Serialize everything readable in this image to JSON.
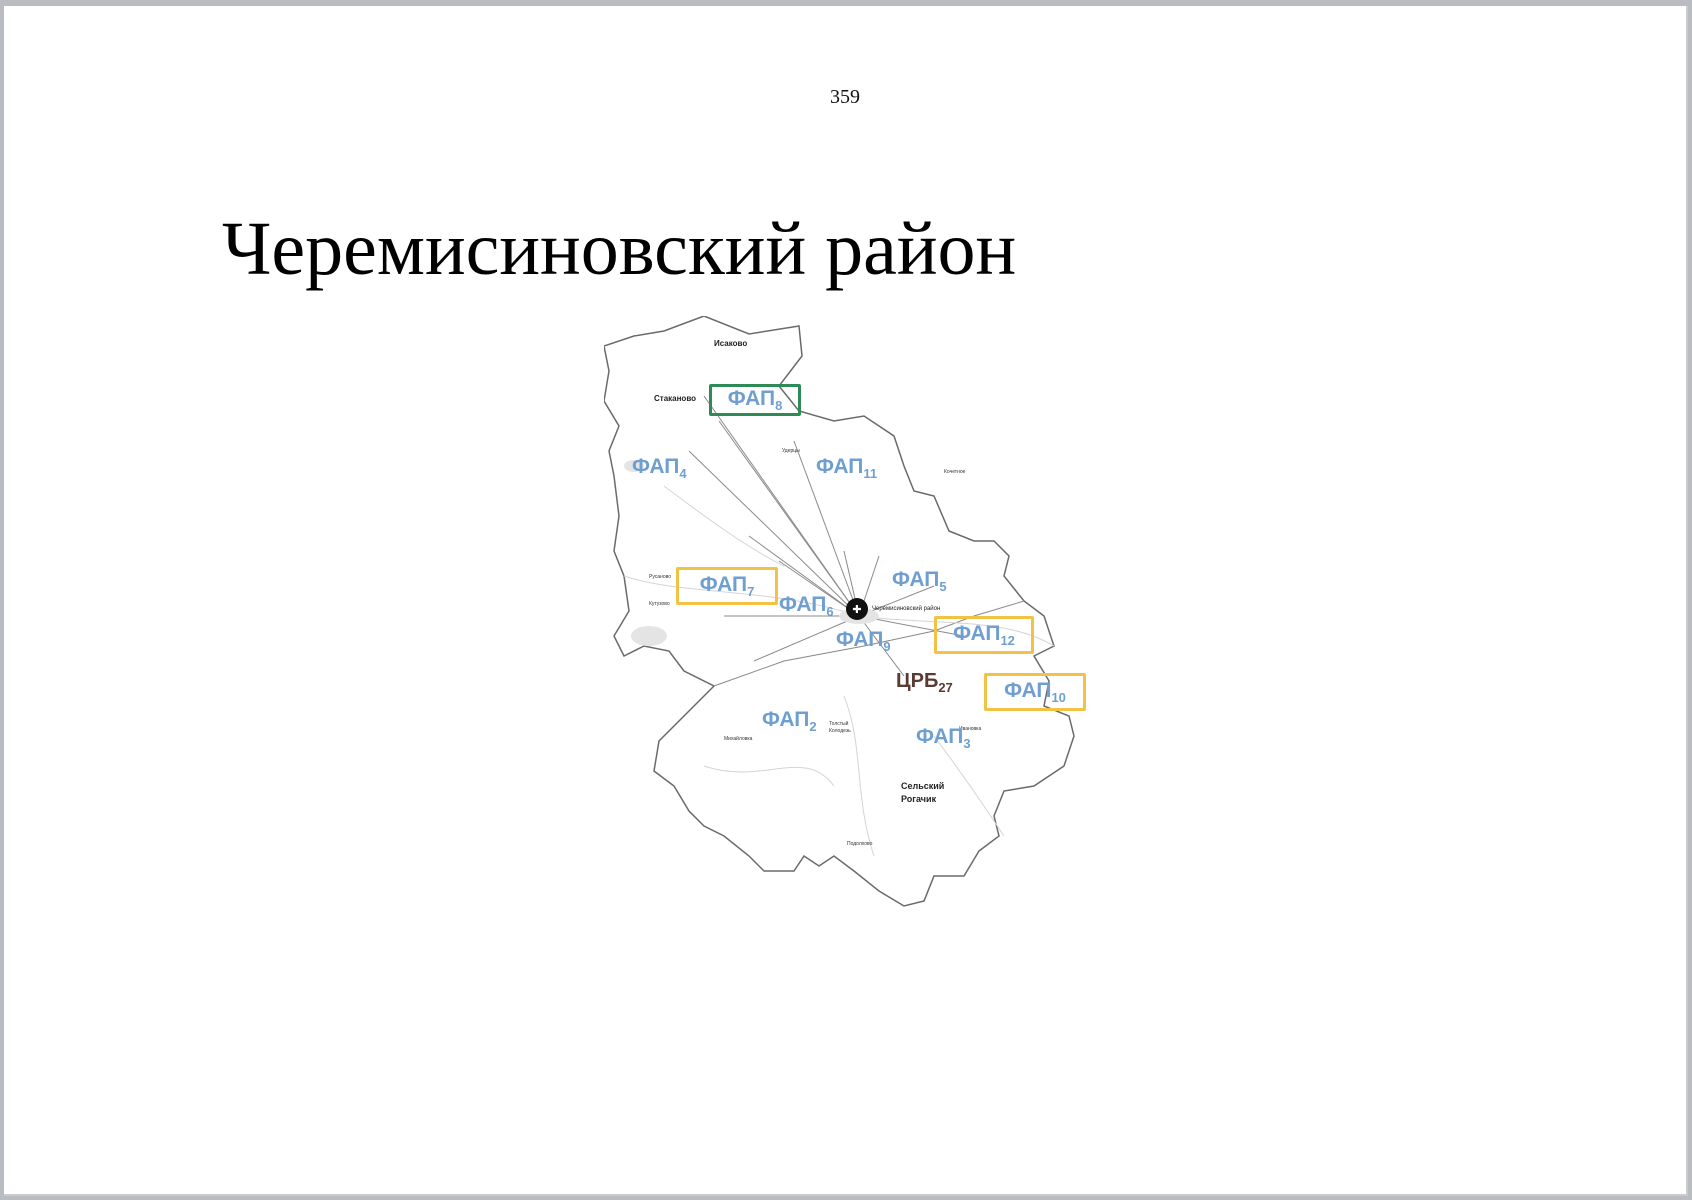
{
  "page": {
    "number": "359",
    "title": "Черемисиновский район"
  },
  "colors": {
    "fap_text": "#6f9fd1",
    "frame_green": "#2e8b57",
    "frame_yellow": "#f3c245",
    "crb_text": "#5a3b33",
    "border": "#6a6a6a"
  },
  "map": {
    "hospital_icon": "hospital-marker-icon",
    "district_name": "Черемисиновский район",
    "crb": {
      "base": "ЦРБ",
      "sub": "27"
    },
    "faps": [
      {
        "id": "fap8",
        "base": "ФАП",
        "sub": "8",
        "frame": "green"
      },
      {
        "id": "fap4",
        "base": "ФАП",
        "sub": "4",
        "frame": "none"
      },
      {
        "id": "fap11",
        "base": "ФАП",
        "sub": "11",
        "frame": "none"
      },
      {
        "id": "fap7",
        "base": "ФАП",
        "sub": "7",
        "frame": "yellow"
      },
      {
        "id": "fap6",
        "base": "ФАП",
        "sub": "6",
        "frame": "none"
      },
      {
        "id": "fap5",
        "base": "ФАП",
        "sub": "5",
        "frame": "none"
      },
      {
        "id": "fap9",
        "base": "ФАП",
        "sub": "9",
        "frame": "none"
      },
      {
        "id": "fap12",
        "base": "ФАП",
        "sub": "12",
        "frame": "yellow"
      },
      {
        "id": "fap10",
        "base": "ФАП",
        "sub": "10",
        "frame": "yellow"
      },
      {
        "id": "fap2",
        "base": "ФАП",
        "sub": "2",
        "frame": "none"
      },
      {
        "id": "fap3",
        "base": "ФАП",
        "sub": "3",
        "frame": "none"
      }
    ],
    "villages": {
      "isakovo": "Исаково",
      "stakanovo": "Стаканово",
      "udercy": "Удерцы",
      "rusanovo": "Русаново",
      "kutuzovo": "Кутузово",
      "selsky_rogachik_1": "Сельский",
      "selsky_rogachik_2": "Рогачик",
      "tolsty_kolodez_1": "Толстый",
      "tolsty_kolodez_2": "Колодезь",
      "mikhaylovka": "Михайловка",
      "podolkhovo": "Подолхово",
      "ivanovka": "Ивановка",
      "kochetnoe": "Кочетное"
    }
  }
}
